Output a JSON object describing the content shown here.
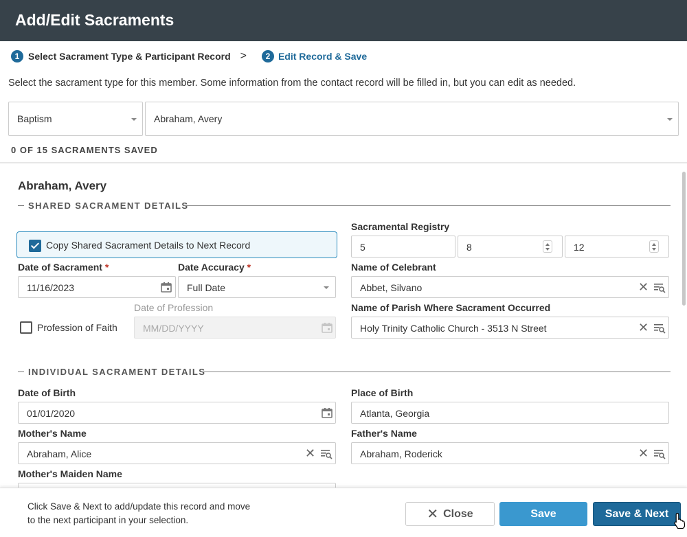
{
  "window": {
    "title": "Add/Edit Sacraments"
  },
  "stepper": {
    "step1": {
      "number": "1",
      "label": "Select Sacrament Type & Participant Record"
    },
    "separator": ">",
    "step2": {
      "number": "2",
      "label": "Edit Record & Save"
    }
  },
  "intro": "Select the sacrament type for this member. Some information from the contact record will be filled in, but you can edit as needed.",
  "selectors": {
    "sacrament_type": "Baptism",
    "participant": "Abraham, Avery"
  },
  "saved_count": "0 OF 15 SACRAMENTS SAVED",
  "record": {
    "name": "Abraham, Avery"
  },
  "shared": {
    "section_title": "SHARED SACRAMENT DETAILS",
    "copy_label": "Copy Shared Sacrament Details to Next Record",
    "copy_checked": true,
    "registry_label": "Sacramental Registry",
    "registry": [
      "5",
      "8",
      "12"
    ],
    "date_label": "Date of Sacrament",
    "date_value": "11/16/2023",
    "accuracy_label": "Date Accuracy",
    "accuracy_value": "Full Date",
    "required_mark": "*",
    "celebrant_label": "Name of Celebrant",
    "celebrant_value": "Abbet, Silvano",
    "profession_label": "Profession of Faith",
    "profession_checked": false,
    "profession_date_label": "Date of Profession",
    "profession_date_placeholder": "MM/DD/YYYY",
    "parish_label": "Name of Parish Where Sacrament Occurred",
    "parish_value": "Holy Trinity Catholic Church - 3513 N Street"
  },
  "individual": {
    "section_title": "INDIVIDUAL SACRAMENT DETAILS",
    "dob_label": "Date of Birth",
    "dob_value": "01/01/2020",
    "pob_label": "Place of Birth",
    "pob_value": "Atlanta, Georgia",
    "mother_label": "Mother's Name",
    "mother_value": "Abraham, Alice",
    "father_label": "Father's Name",
    "father_value": "Abraham, Roderick",
    "maiden_label": "Mother's Maiden Name"
  },
  "footer": {
    "text": "Click Save & Next to add/update this record and move to the next participant in your selection.",
    "close_label": "Close",
    "save_label": "Save",
    "save_next_label": "Save & Next"
  },
  "colors": {
    "header_bg": "#37424a",
    "primary": "#1f6a9a",
    "save": "#3a98cf",
    "required": "#c0392b"
  }
}
